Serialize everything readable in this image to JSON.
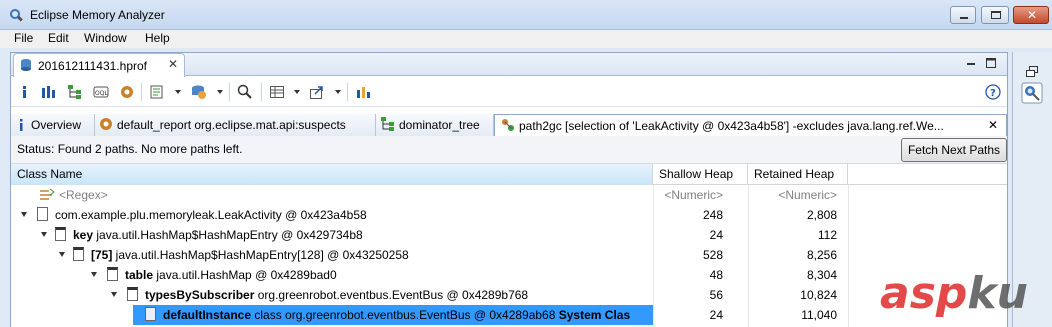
{
  "window": {
    "title": "Eclipse Memory Analyzer"
  },
  "menu": [
    "File",
    "Edit",
    "Window",
    "Help"
  ],
  "editor_tab": {
    "label": "201612111431.hprof"
  },
  "subtabs": [
    {
      "label": "Overview"
    },
    {
      "label": "default_report  org.eclipse.mat.api:suspects"
    },
    {
      "label": "dominator_tree"
    },
    {
      "label": "path2gc [selection of 'LeakActivity @ 0x423a4b58'] -excludes java.lang.ref.We..."
    }
  ],
  "status": {
    "text": "Status:  Found 2 paths. No more paths left.",
    "fetch_button": "Fetch Next Paths"
  },
  "table": {
    "columns": [
      "Class Name",
      "Shallow Heap",
      "Retained Heap"
    ],
    "filter_row": {
      "name": "<Regex>",
      "shallow": "<Numeric>",
      "retained": "<Numeric>"
    },
    "rows": [
      {
        "field": "",
        "text": "com.example.plu.memoryleak.LeakActivity @ 0x423a4b58",
        "shallow": "248",
        "retained": "2,808"
      },
      {
        "field": "key",
        "text": " java.util.HashMap$HashMapEntry @ 0x429734b8",
        "shallow": "24",
        "retained": "112"
      },
      {
        "field": "[75]",
        "text": " java.util.HashMap$HashMapEntry[128] @ 0x43250258",
        "shallow": "528",
        "retained": "8,256"
      },
      {
        "field": "table",
        "text": " java.util.HashMap @ 0x4289bad0",
        "shallow": "48",
        "retained": "8,304"
      },
      {
        "field": "typesBySubscriber",
        "text": " org.greenrobot.eventbus.EventBus @ 0x4289b768",
        "shallow": "56",
        "retained": "10,824"
      },
      {
        "field": "defaultInstance",
        "text": " class org.greenrobot.eventbus.EventBus @ 0x4289ab68 ",
        "suffix": "System Clas",
        "shallow": "24",
        "retained": "11,040"
      }
    ]
  },
  "colors": {
    "selection": "#3399ff",
    "header_active": "#c9e5f9",
    "close_button": "#c44a2c"
  }
}
